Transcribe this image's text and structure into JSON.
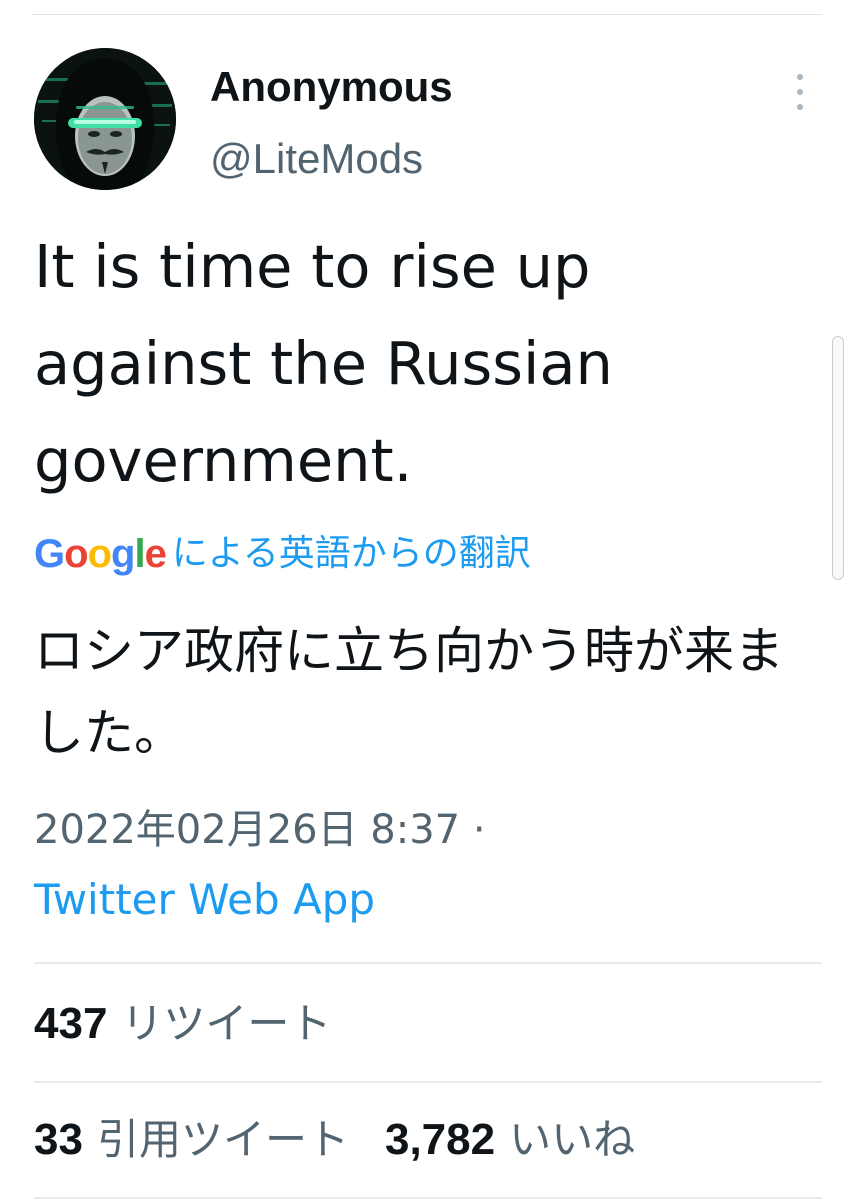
{
  "author": {
    "display_name": "Anonymous",
    "handle": "@LiteMods"
  },
  "tweet": {
    "text": "It is time to rise up against the Russian government.",
    "translation_credit": {
      "logo_letters": [
        {
          "char": "G",
          "color": "#4285F4"
        },
        {
          "char": "o",
          "color": "#EA4335"
        },
        {
          "char": "o",
          "color": "#FBBC05"
        },
        {
          "char": "g",
          "color": "#4285F4"
        },
        {
          "char": "l",
          "color": "#34A853"
        },
        {
          "char": "e",
          "color": "#EA4335"
        }
      ],
      "label": "による英語からの翻訳"
    },
    "translated_text": "ロシア政府に立ち向かう時が来ました。",
    "timestamp": "2022年02月26日 8:37 ·",
    "source": "Twitter Web App"
  },
  "stats": {
    "retweets": {
      "count": "437",
      "label": "リツイート"
    },
    "quotes": {
      "count": "33",
      "label": "引用ツイート"
    },
    "likes": {
      "count": "3,782",
      "label": "いいね"
    }
  },
  "icons": {
    "more": "more-vertical-icon",
    "avatar": "guy-fawkes-mask-avatar"
  },
  "colors": {
    "link_blue": "#1d9bf0",
    "secondary_gray": "#536471",
    "text": "#0f1419"
  }
}
